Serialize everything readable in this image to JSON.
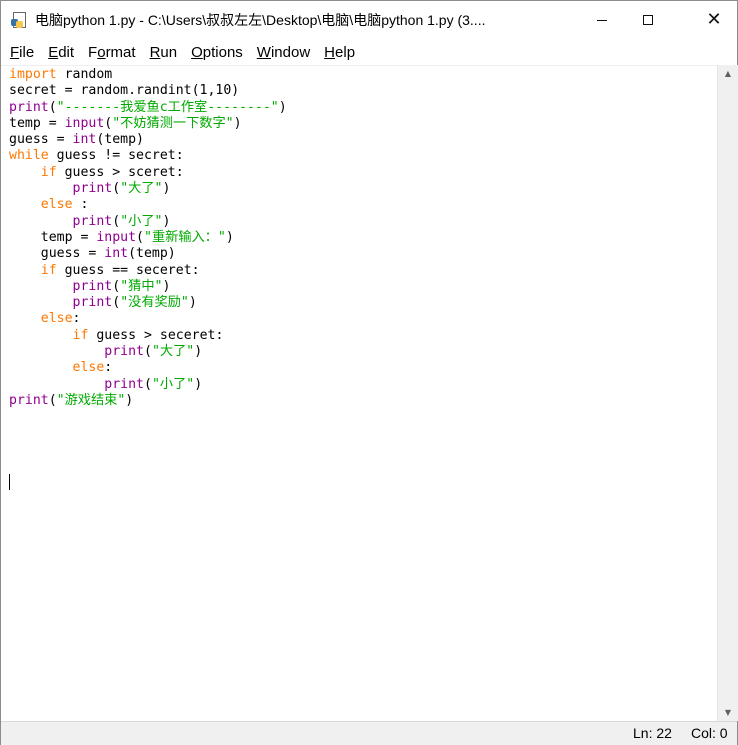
{
  "window": {
    "title": "电脑python 1.py - C:\\Users\\叔叔左左\\Desktop\\电脑\\电脑python 1.py (3...."
  },
  "menu": {
    "items": [
      {
        "label": "File",
        "u": "F",
        "rest": "ile"
      },
      {
        "label": "Edit",
        "u": "E",
        "rest": "dit"
      },
      {
        "label": "Format",
        "pre": "F",
        "u": "o",
        "rest": "rmat"
      },
      {
        "label": "Run",
        "u": "R",
        "rest": "un"
      },
      {
        "label": "Options",
        "u": "O",
        "rest": "ptions"
      },
      {
        "label": "Window",
        "u": "W",
        "rest": "indow"
      },
      {
        "label": "Help",
        "u": "H",
        "rest": "elp"
      }
    ]
  },
  "editor": {
    "lines": [
      [
        {
          "t": "import",
          "c": "kw"
        },
        {
          "t": " random"
        }
      ],
      [
        {
          "t": "secret = random.randint(1,10)"
        }
      ],
      [
        {
          "t": "print",
          "c": "bi"
        },
        {
          "t": "(\"-------我爱鱼c工作室--------\")",
          "c": "st",
          "p": true
        }
      ],
      [
        {
          "t": "temp = "
        },
        {
          "t": "input",
          "c": "bi"
        },
        {
          "t": "(\"不妨猜测一下数字\")",
          "c": "st",
          "p": true
        }
      ],
      [
        {
          "t": "guess = "
        },
        {
          "t": "int",
          "c": "bi"
        },
        {
          "t": "(temp)"
        }
      ],
      [
        {
          "t": "while",
          "c": "kw"
        },
        {
          "t": " guess != secret:"
        }
      ],
      [
        {
          "t": "    "
        },
        {
          "t": "if",
          "c": "kw"
        },
        {
          "t": " guess > sceret:"
        }
      ],
      [
        {
          "t": "        "
        },
        {
          "t": "print",
          "c": "bi"
        },
        {
          "t": "(\"大了\")",
          "c": "st",
          "p": true
        }
      ],
      [
        {
          "t": "    "
        },
        {
          "t": "else",
          "c": "kw"
        },
        {
          "t": " :"
        }
      ],
      [
        {
          "t": "        "
        },
        {
          "t": "print",
          "c": "bi"
        },
        {
          "t": "(\"小了\")",
          "c": "st",
          "p": true
        }
      ],
      [
        {
          "t": "    temp = "
        },
        {
          "t": "input",
          "c": "bi"
        },
        {
          "t": "(\"重新输入：\")",
          "c": "st",
          "p": true
        }
      ],
      [
        {
          "t": "    guess = "
        },
        {
          "t": "int",
          "c": "bi"
        },
        {
          "t": "(temp)"
        }
      ],
      [
        {
          "t": "    "
        },
        {
          "t": "if",
          "c": "kw"
        },
        {
          "t": " guess == seceret:"
        }
      ],
      [
        {
          "t": "        "
        },
        {
          "t": "print",
          "c": "bi"
        },
        {
          "t": "(\"猜中\")",
          "c": "st",
          "p": true
        }
      ],
      [
        {
          "t": "        "
        },
        {
          "t": "print",
          "c": "bi"
        },
        {
          "t": "(\"没有奖励\")",
          "c": "st",
          "p": true
        }
      ],
      [
        {
          "t": "    "
        },
        {
          "t": "else",
          "c": "kw"
        },
        {
          "t": ":"
        }
      ],
      [
        {
          "t": "        "
        },
        {
          "t": "if",
          "c": "kw"
        },
        {
          "t": " guess > seceret:"
        }
      ],
      [
        {
          "t": "            "
        },
        {
          "t": "print",
          "c": "bi"
        },
        {
          "t": "(\"大了\")",
          "c": "st",
          "p": true
        }
      ],
      [
        {
          "t": "        "
        },
        {
          "t": "else",
          "c": "kw"
        },
        {
          "t": ":"
        }
      ],
      [
        {
          "t": "            "
        },
        {
          "t": "print",
          "c": "bi"
        },
        {
          "t": "(\"小了\")",
          "c": "st",
          "p": true
        }
      ],
      [
        {
          "t": "print",
          "c": "bi"
        },
        {
          "t": "(\"游戏结束\")",
          "c": "st",
          "p": true
        }
      ]
    ]
  },
  "status": {
    "ln": "Ln: 22",
    "col": "Col: 0"
  }
}
